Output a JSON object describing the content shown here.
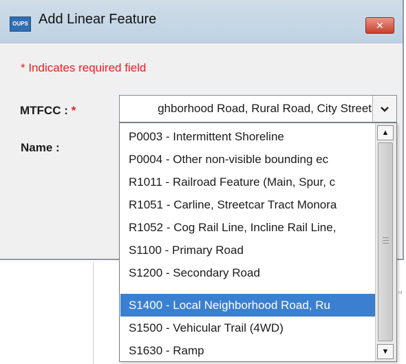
{
  "dialog": {
    "app_icon_text": "OUPS",
    "title": "Add Linear Feature",
    "close_icon": "close-x-icon",
    "required_note": "* Indicates required field"
  },
  "form": {
    "mtfcc_label": "MTFCC :",
    "required_star": "*",
    "name_label": "Name :",
    "mtfcc_value": "ghborhood Road, Rural Road, City Street",
    "dropdown_arrow_icon": "chevron-down-icon"
  },
  "dropdown": {
    "options": [
      "P0003 - Intermittent Shoreline",
      "P0004 - Other non-visible bounding ec",
      "R1011 - Railroad Feature (Main, Spur, c",
      "R1051 - Carline, Streetcar Tract Monora",
      "R1052 - Cog Rail Line, Incline Rail Line,",
      "S1100 - Primary Road",
      "S1200 - Secondary Road",
      "S1400 - Local Neighborhood Road, Ru",
      "S1500 - Vehicular Trail (4WD)",
      "S1630 - Ramp"
    ],
    "selected_index": 7
  },
  "background": {
    "fragment": "rd"
  },
  "colors": {
    "accent": "#3b7fd1",
    "required": "#e52121",
    "titlebar": "#c7d8e8",
    "close": "#c8412e"
  }
}
